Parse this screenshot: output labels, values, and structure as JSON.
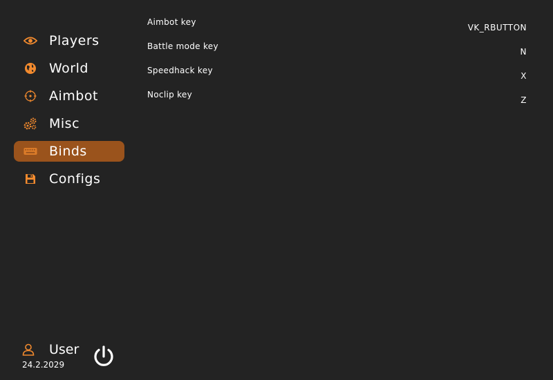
{
  "sidebar": {
    "items": [
      {
        "label": "Players",
        "icon": "eye-icon",
        "active": false
      },
      {
        "label": "World",
        "icon": "globe-icon",
        "active": false
      },
      {
        "label": "Aimbot",
        "icon": "crosshair-icon",
        "active": false
      },
      {
        "label": "Misc",
        "icon": "gears-icon",
        "active": false
      },
      {
        "label": "Binds",
        "icon": "keyboard-icon",
        "active": true
      },
      {
        "label": "Configs",
        "icon": "floppy-disk-icon",
        "active": false
      }
    ]
  },
  "binds": [
    {
      "label": "Aimbot key",
      "value": "VK_RBUTTON"
    },
    {
      "label": "Battle mode key",
      "value": "N"
    },
    {
      "label": "Speedhack key",
      "value": "X"
    },
    {
      "label": "Noclip key",
      "value": "Z"
    }
  ],
  "user": {
    "name": "User",
    "date": "24.2.2029",
    "icon": "user-icon"
  },
  "footer": {
    "power_icon": "power-icon"
  },
  "colors": {
    "background": "#232323",
    "accent": "#f28a2e",
    "active_item": "#9a531c",
    "text": "#ffffff"
  }
}
